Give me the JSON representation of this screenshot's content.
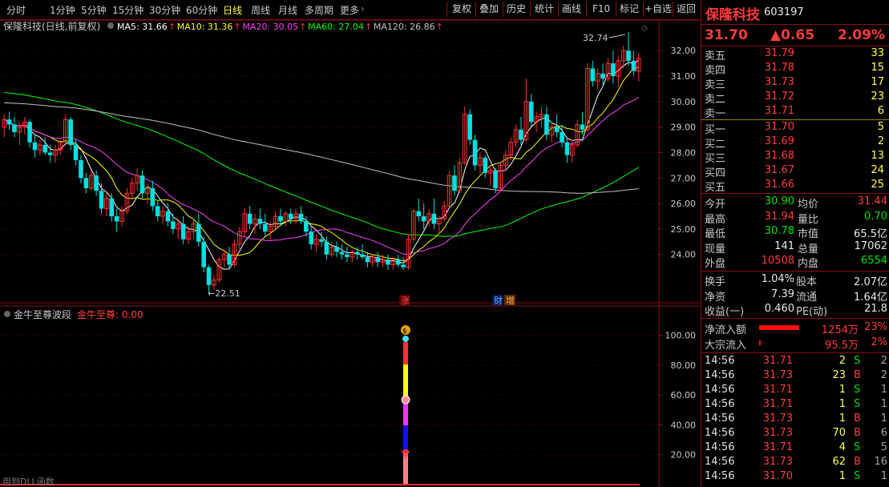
{
  "toolbar": {
    "periods": [
      "分时",
      "1分钟",
      "5分钟",
      "15分钟",
      "30分钟",
      "60分钟",
      "日线",
      "周线",
      "月线",
      "多周期",
      "更多"
    ],
    "active_period": "日线",
    "actions": [
      "复权",
      "叠加",
      "历史",
      "统计",
      "画线",
      "F10",
      "标记",
      "+自选",
      "返回"
    ]
  },
  "main_chart": {
    "title": "保隆科技(日线,前复权)",
    "ma": [
      {
        "label": "MA5: 31.66",
        "color": "#ffffff"
      },
      {
        "label": "MA10: 31.36",
        "color": "#ffff00"
      },
      {
        "label": "MA20: 30.05",
        "color": "#ff40ff"
      },
      {
        "label": "MA60: 27.04",
        "color": "#00ff00"
      },
      {
        "label": "MA120: 26.86",
        "color": "#c0c0c0"
      }
    ],
    "y_ticks": [
      "32.00",
      "31.00",
      "30.00",
      "29.00",
      "28.00",
      "27.00",
      "26.00",
      "25.00",
      "24.00"
    ],
    "high_label": "32.74",
    "low_label": "22.51",
    "event_zhang": "涨",
    "event_cai": "财",
    "event_zeng": "增"
  },
  "sub_chart": {
    "title": "金牛至尊波段",
    "value_label": "金牛至尊: 0.00",
    "y_ticks": [
      "100.00",
      "80.00",
      "60.00",
      "40.00",
      "20.00"
    ],
    "footer": "用到DLL函数"
  },
  "chart_data": {
    "type": "candlestick",
    "ylim": [
      22.2,
      33.2
    ],
    "y_ticks": [
      24,
      25,
      26,
      27,
      28,
      29,
      30,
      31,
      32
    ],
    "up_color": "#ff3030",
    "down_color": "#00e0e0",
    "candles": [
      [
        29.0,
        29.5,
        28.6,
        29.3
      ],
      [
        29.3,
        29.6,
        28.9,
        29.1
      ],
      [
        29.1,
        29.4,
        28.6,
        28.8
      ],
      [
        28.8,
        29.2,
        28.3,
        29.0
      ],
      [
        29.0,
        29.4,
        28.7,
        29.2
      ],
      [
        29.2,
        29.3,
        28.2,
        28.4
      ],
      [
        28.4,
        28.7,
        27.8,
        28.1
      ],
      [
        28.1,
        28.5,
        27.9,
        28.3
      ],
      [
        28.3,
        28.6,
        27.9,
        28.0
      ],
      [
        28.0,
        28.3,
        27.6,
        27.9
      ],
      [
        27.9,
        28.3,
        27.6,
        28.1
      ],
      [
        28.1,
        28.5,
        27.9,
        28.4
      ],
      [
        28.4,
        29.5,
        28.3,
        29.3
      ],
      [
        29.3,
        29.4,
        28.1,
        28.3
      ],
      [
        28.3,
        28.5,
        27.5,
        27.7
      ],
      [
        27.7,
        27.9,
        26.8,
        27.0
      ],
      [
        27.0,
        27.2,
        26.4,
        26.6
      ],
      [
        26.6,
        27.3,
        26.5,
        27.1
      ],
      [
        27.1,
        27.3,
        26.3,
        26.5
      ],
      [
        26.5,
        26.8,
        25.6,
        25.8
      ],
      [
        25.8,
        26.4,
        25.5,
        26.2
      ],
      [
        26.2,
        26.4,
        25.3,
        25.5
      ],
      [
        25.5,
        25.8,
        24.9,
        25.3
      ],
      [
        25.3,
        25.9,
        25.1,
        25.7
      ],
      [
        25.7,
        26.6,
        25.6,
        26.4
      ],
      [
        26.4,
        27.0,
        26.2,
        26.8
      ],
      [
        26.8,
        27.4,
        26.5,
        27.1
      ],
      [
        27.1,
        27.3,
        26.2,
        26.4
      ],
      [
        26.4,
        26.8,
        26.0,
        26.6
      ],
      [
        26.6,
        26.9,
        25.7,
        25.9
      ],
      [
        25.9,
        26.1,
        25.3,
        25.5
      ],
      [
        25.5,
        25.9,
        25.2,
        25.7
      ],
      [
        25.7,
        26.0,
        25.1,
        25.3
      ],
      [
        25.3,
        25.6,
        24.8,
        25.0
      ],
      [
        25.0,
        25.4,
        24.6,
        25.2
      ],
      [
        25.2,
        25.5,
        24.4,
        24.6
      ],
      [
        24.6,
        25.1,
        24.4,
        24.9
      ],
      [
        24.9,
        25.4,
        24.6,
        25.2
      ],
      [
        25.2,
        25.6,
        24.3,
        24.5
      ],
      [
        24.5,
        24.7,
        23.3,
        23.5
      ],
      [
        23.5,
        23.6,
        22.51,
        22.8
      ],
      [
        22.8,
        23.2,
        22.6,
        23.0
      ],
      [
        23.0,
        23.9,
        22.9,
        23.8
      ],
      [
        23.8,
        24.2,
        23.5,
        24.0
      ],
      [
        24.0,
        24.3,
        23.4,
        23.6
      ],
      [
        23.6,
        24.6,
        23.5,
        24.4
      ],
      [
        24.4,
        25.1,
        24.2,
        24.9
      ],
      [
        24.9,
        25.8,
        24.7,
        25.6
      ],
      [
        25.6,
        25.9,
        25.0,
        25.2
      ],
      [
        25.2,
        25.6,
        24.8,
        25.4
      ],
      [
        25.4,
        25.8,
        25.0,
        25.2
      ],
      [
        25.2,
        25.6,
        24.7,
        24.9
      ],
      [
        24.9,
        25.3,
        24.6,
        25.1
      ],
      [
        25.1,
        25.7,
        25.0,
        25.5
      ],
      [
        25.5,
        25.8,
        25.1,
        25.3
      ],
      [
        25.3,
        25.7,
        25.1,
        25.6
      ],
      [
        25.6,
        25.8,
        25.2,
        25.4
      ],
      [
        25.4,
        25.8,
        25.2,
        25.6
      ],
      [
        25.6,
        25.9,
        25.2,
        25.3
      ],
      [
        25.3,
        25.5,
        24.7,
        24.9
      ],
      [
        24.9,
        25.1,
        24.2,
        24.4
      ],
      [
        24.4,
        24.8,
        24.1,
        24.6
      ],
      [
        24.6,
        24.9,
        24.3,
        24.5
      ],
      [
        24.5,
        24.7,
        23.8,
        24.0
      ],
      [
        24.0,
        24.5,
        23.9,
        24.3
      ],
      [
        24.3,
        24.5,
        23.9,
        24.1
      ],
      [
        24.1,
        24.4,
        23.8,
        24.0
      ],
      [
        24.0,
        24.3,
        23.7,
        23.9
      ],
      [
        23.9,
        24.2,
        23.7,
        24.1
      ],
      [
        24.1,
        24.3,
        23.8,
        24.0
      ],
      [
        24.0,
        24.4,
        23.8,
        23.9
      ],
      [
        23.9,
        24.1,
        23.5,
        23.7
      ],
      [
        23.7,
        24.0,
        23.5,
        23.9
      ],
      [
        23.9,
        24.1,
        23.5,
        23.7
      ],
      [
        23.7,
        24.0,
        23.5,
        23.8
      ],
      [
        23.8,
        24.0,
        23.4,
        23.6
      ],
      [
        23.6,
        23.9,
        23.4,
        23.8
      ],
      [
        23.8,
        24.0,
        23.5,
        23.6
      ],
      [
        23.6,
        23.9,
        23.4,
        23.5
      ],
      [
        23.5,
        24.8,
        23.4,
        24.6
      ],
      [
        24.6,
        25.8,
        24.5,
        25.7
      ],
      [
        25.7,
        26.2,
        25.3,
        25.5
      ],
      [
        25.5,
        26.0,
        25.0,
        25.3
      ],
      [
        25.3,
        25.8,
        25.1,
        25.6
      ],
      [
        25.6,
        26.2,
        25.0,
        25.2
      ],
      [
        25.2,
        25.5,
        24.8,
        25.4
      ],
      [
        25.4,
        26.1,
        25.3,
        25.9
      ],
      [
        25.9,
        27.3,
        25.8,
        27.1
      ],
      [
        27.1,
        27.5,
        26.3,
        26.5
      ],
      [
        26.5,
        27.8,
        26.4,
        27.6
      ],
      [
        27.6,
        29.8,
        27.5,
        29.5
      ],
      [
        29.5,
        29.7,
        28.3,
        28.5
      ],
      [
        28.5,
        28.7,
        27.3,
        27.5
      ],
      [
        27.5,
        28.0,
        27.2,
        27.8
      ],
      [
        27.8,
        27.9,
        27.0,
        27.2
      ],
      [
        27.2,
        27.5,
        26.7,
        27.3
      ],
      [
        27.3,
        27.4,
        26.4,
        26.6
      ],
      [
        26.6,
        27.6,
        26.5,
        27.5
      ],
      [
        27.5,
        28.1,
        27.3,
        27.9
      ],
      [
        27.9,
        28.6,
        27.7,
        28.4
      ],
      [
        28.4,
        29.1,
        28.2,
        28.9
      ],
      [
        28.9,
        29.4,
        28.3,
        28.5
      ],
      [
        28.5,
        30.9,
        28.4,
        30.0
      ],
      [
        30.0,
        30.3,
        29.0,
        29.2
      ],
      [
        29.2,
        29.6,
        28.8,
        29.4
      ],
      [
        29.4,
        29.8,
        29.0,
        29.5
      ],
      [
        29.5,
        29.8,
        28.5,
        28.7
      ],
      [
        28.7,
        29.2,
        28.4,
        29.0
      ],
      [
        29.0,
        29.5,
        28.6,
        28.8
      ],
      [
        28.8,
        29.1,
        28.2,
        28.4
      ],
      [
        28.4,
        28.6,
        27.6,
        27.9
      ],
      [
        27.9,
        28.5,
        27.6,
        28.3
      ],
      [
        28.3,
        29.3,
        28.2,
        29.1
      ],
      [
        29.1,
        29.6,
        28.7,
        28.9
      ],
      [
        28.9,
        31.5,
        28.8,
        31.3
      ],
      [
        31.3,
        31.6,
        30.6,
        30.8
      ],
      [
        30.8,
        31.3,
        30.5,
        31.1
      ],
      [
        31.1,
        31.5,
        30.6,
        30.9
      ],
      [
        30.9,
        31.7,
        30.8,
        31.5
      ],
      [
        31.5,
        32.0,
        30.7,
        31.0
      ],
      [
        31.0,
        31.8,
        30.6,
        31.6
      ],
      [
        31.6,
        32.2,
        31.3,
        32.0
      ],
      [
        32.0,
        32.74,
        31.4,
        31.6
      ],
      [
        31.6,
        32.0,
        31.0,
        31.2
      ],
      [
        31.2,
        31.9,
        30.78,
        31.7
      ]
    ]
  },
  "right_panel": {
    "stock_name": "保隆科技",
    "stock_code": "603197",
    "price": "31.70",
    "change": "▲0.65",
    "change_pct": "2.09%",
    "asks": [
      {
        "label": "卖五",
        "price": "31.79",
        "vol": "33"
      },
      {
        "label": "卖四",
        "price": "31.78",
        "vol": "15"
      },
      {
        "label": "卖三",
        "price": "31.73",
        "vol": "17"
      },
      {
        "label": "卖二",
        "price": "31.72",
        "vol": "23"
      },
      {
        "label": "卖一",
        "price": "31.71",
        "vol": "6"
      }
    ],
    "bids": [
      {
        "label": "买一",
        "price": "31.70",
        "vol": "5"
      },
      {
        "label": "买二",
        "price": "31.69",
        "vol": "2"
      },
      {
        "label": "买三",
        "price": "31.68",
        "vol": "13"
      },
      {
        "label": "买四",
        "price": "31.67",
        "vol": "24"
      },
      {
        "label": "买五",
        "price": "31.66",
        "vol": "25"
      }
    ],
    "stats": [
      {
        "l1": "今开",
        "v1": "30.90",
        "c1": "grn",
        "l2": "均价",
        "v2": "31.44",
        "c2": "red"
      },
      {
        "l1": "最高",
        "v1": "31.94",
        "c1": "red",
        "l2": "量比",
        "v2": "0.70",
        "c2": "grn"
      },
      {
        "l1": "最低",
        "v1": "30.78",
        "c1": "grn",
        "l2": "市值",
        "v2": "65.5亿",
        "c2": "wht"
      },
      {
        "l1": "现量",
        "v1": "141",
        "c1": "wht",
        "l2": "总量",
        "v2": "17062",
        "c2": "wht"
      },
      {
        "l1": "外盘",
        "v1": "10508",
        "c1": "red",
        "l2": "内盘",
        "v2": "6554",
        "c2": "grn"
      }
    ],
    "stats2": [
      {
        "l1": "换手",
        "v1": "1.04%",
        "l2": "股本",
        "v2": "2.07亿"
      },
      {
        "l1": "净资",
        "v1": "7.39",
        "l2": "流通",
        "v2": "1.64亿"
      },
      {
        "l1": "收益(一)",
        "v1": "0.460",
        "l2": "PE(动)",
        "v2": "21.8"
      }
    ],
    "flows": [
      {
        "label": "净流入额",
        "amount": "1254万",
        "pct": "23%",
        "bar": 0.9
      },
      {
        "label": "大宗流入",
        "amount": "95.5万",
        "pct": "2%",
        "bar": 0.04
      }
    ],
    "ticks": [
      {
        "time": "14:56",
        "price": "31.71",
        "vol": "2",
        "side": "S",
        "n": "2"
      },
      {
        "time": "14:56",
        "price": "31.73",
        "vol": "23",
        "side": "B",
        "n": "2"
      },
      {
        "time": "14:56",
        "price": "31.71",
        "vol": "1",
        "side": "S",
        "n": "1"
      },
      {
        "time": "14:56",
        "price": "31.71",
        "vol": "1",
        "side": "S",
        "n": "1"
      },
      {
        "time": "14:56",
        "price": "31.73",
        "vol": "1",
        "side": "B",
        "n": "1"
      },
      {
        "time": "14:56",
        "price": "31.73",
        "vol": "70",
        "side": "B",
        "n": "6"
      },
      {
        "time": "14:56",
        "price": "31.71",
        "vol": "4",
        "side": "S",
        "n": "5"
      },
      {
        "time": "14:56",
        "price": "31.73",
        "vol": "62",
        "side": "B",
        "n": "16"
      },
      {
        "time": "14:56",
        "price": "31.70",
        "vol": "1",
        "side": "S",
        "n": "1"
      }
    ]
  }
}
